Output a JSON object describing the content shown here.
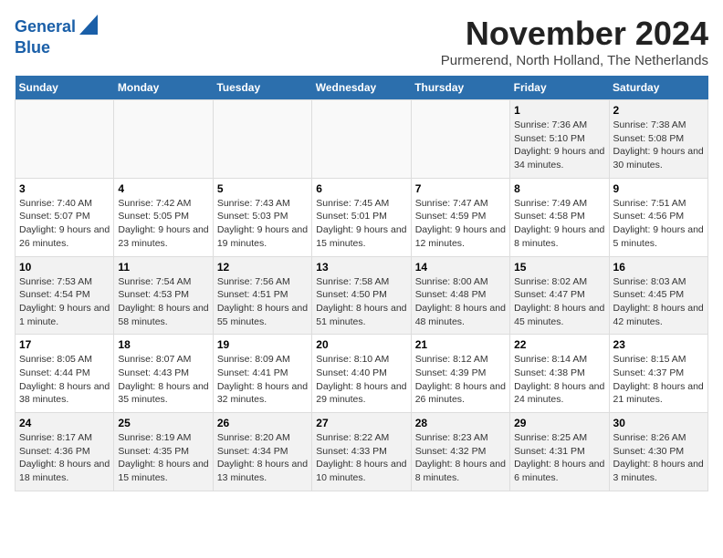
{
  "logo": {
    "line1": "General",
    "line2": "Blue"
  },
  "title": "November 2024",
  "location": "Purmerend, North Holland, The Netherlands",
  "days_of_week": [
    "Sunday",
    "Monday",
    "Tuesday",
    "Wednesday",
    "Thursday",
    "Friday",
    "Saturday"
  ],
  "weeks": [
    [
      {
        "day": "",
        "info": ""
      },
      {
        "day": "",
        "info": ""
      },
      {
        "day": "",
        "info": ""
      },
      {
        "day": "",
        "info": ""
      },
      {
        "day": "",
        "info": ""
      },
      {
        "day": "1",
        "info": "Sunrise: 7:36 AM\nSunset: 5:10 PM\nDaylight: 9 hours and 34 minutes."
      },
      {
        "day": "2",
        "info": "Sunrise: 7:38 AM\nSunset: 5:08 PM\nDaylight: 9 hours and 30 minutes."
      }
    ],
    [
      {
        "day": "3",
        "info": "Sunrise: 7:40 AM\nSunset: 5:07 PM\nDaylight: 9 hours and 26 minutes."
      },
      {
        "day": "4",
        "info": "Sunrise: 7:42 AM\nSunset: 5:05 PM\nDaylight: 9 hours and 23 minutes."
      },
      {
        "day": "5",
        "info": "Sunrise: 7:43 AM\nSunset: 5:03 PM\nDaylight: 9 hours and 19 minutes."
      },
      {
        "day": "6",
        "info": "Sunrise: 7:45 AM\nSunset: 5:01 PM\nDaylight: 9 hours and 15 minutes."
      },
      {
        "day": "7",
        "info": "Sunrise: 7:47 AM\nSunset: 4:59 PM\nDaylight: 9 hours and 12 minutes."
      },
      {
        "day": "8",
        "info": "Sunrise: 7:49 AM\nSunset: 4:58 PM\nDaylight: 9 hours and 8 minutes."
      },
      {
        "day": "9",
        "info": "Sunrise: 7:51 AM\nSunset: 4:56 PM\nDaylight: 9 hours and 5 minutes."
      }
    ],
    [
      {
        "day": "10",
        "info": "Sunrise: 7:53 AM\nSunset: 4:54 PM\nDaylight: 9 hours and 1 minute."
      },
      {
        "day": "11",
        "info": "Sunrise: 7:54 AM\nSunset: 4:53 PM\nDaylight: 8 hours and 58 minutes."
      },
      {
        "day": "12",
        "info": "Sunrise: 7:56 AM\nSunset: 4:51 PM\nDaylight: 8 hours and 55 minutes."
      },
      {
        "day": "13",
        "info": "Sunrise: 7:58 AM\nSunset: 4:50 PM\nDaylight: 8 hours and 51 minutes."
      },
      {
        "day": "14",
        "info": "Sunrise: 8:00 AM\nSunset: 4:48 PM\nDaylight: 8 hours and 48 minutes."
      },
      {
        "day": "15",
        "info": "Sunrise: 8:02 AM\nSunset: 4:47 PM\nDaylight: 8 hours and 45 minutes."
      },
      {
        "day": "16",
        "info": "Sunrise: 8:03 AM\nSunset: 4:45 PM\nDaylight: 8 hours and 42 minutes."
      }
    ],
    [
      {
        "day": "17",
        "info": "Sunrise: 8:05 AM\nSunset: 4:44 PM\nDaylight: 8 hours and 38 minutes."
      },
      {
        "day": "18",
        "info": "Sunrise: 8:07 AM\nSunset: 4:43 PM\nDaylight: 8 hours and 35 minutes."
      },
      {
        "day": "19",
        "info": "Sunrise: 8:09 AM\nSunset: 4:41 PM\nDaylight: 8 hours and 32 minutes."
      },
      {
        "day": "20",
        "info": "Sunrise: 8:10 AM\nSunset: 4:40 PM\nDaylight: 8 hours and 29 minutes."
      },
      {
        "day": "21",
        "info": "Sunrise: 8:12 AM\nSunset: 4:39 PM\nDaylight: 8 hours and 26 minutes."
      },
      {
        "day": "22",
        "info": "Sunrise: 8:14 AM\nSunset: 4:38 PM\nDaylight: 8 hours and 24 minutes."
      },
      {
        "day": "23",
        "info": "Sunrise: 8:15 AM\nSunset: 4:37 PM\nDaylight: 8 hours and 21 minutes."
      }
    ],
    [
      {
        "day": "24",
        "info": "Sunrise: 8:17 AM\nSunset: 4:36 PM\nDaylight: 8 hours and 18 minutes."
      },
      {
        "day": "25",
        "info": "Sunrise: 8:19 AM\nSunset: 4:35 PM\nDaylight: 8 hours and 15 minutes."
      },
      {
        "day": "26",
        "info": "Sunrise: 8:20 AM\nSunset: 4:34 PM\nDaylight: 8 hours and 13 minutes."
      },
      {
        "day": "27",
        "info": "Sunrise: 8:22 AM\nSunset: 4:33 PM\nDaylight: 8 hours and 10 minutes."
      },
      {
        "day": "28",
        "info": "Sunrise: 8:23 AM\nSunset: 4:32 PM\nDaylight: 8 hours and 8 minutes."
      },
      {
        "day": "29",
        "info": "Sunrise: 8:25 AM\nSunset: 4:31 PM\nDaylight: 8 hours and 6 minutes."
      },
      {
        "day": "30",
        "info": "Sunrise: 8:26 AM\nSunset: 4:30 PM\nDaylight: 8 hours and 3 minutes."
      }
    ]
  ]
}
